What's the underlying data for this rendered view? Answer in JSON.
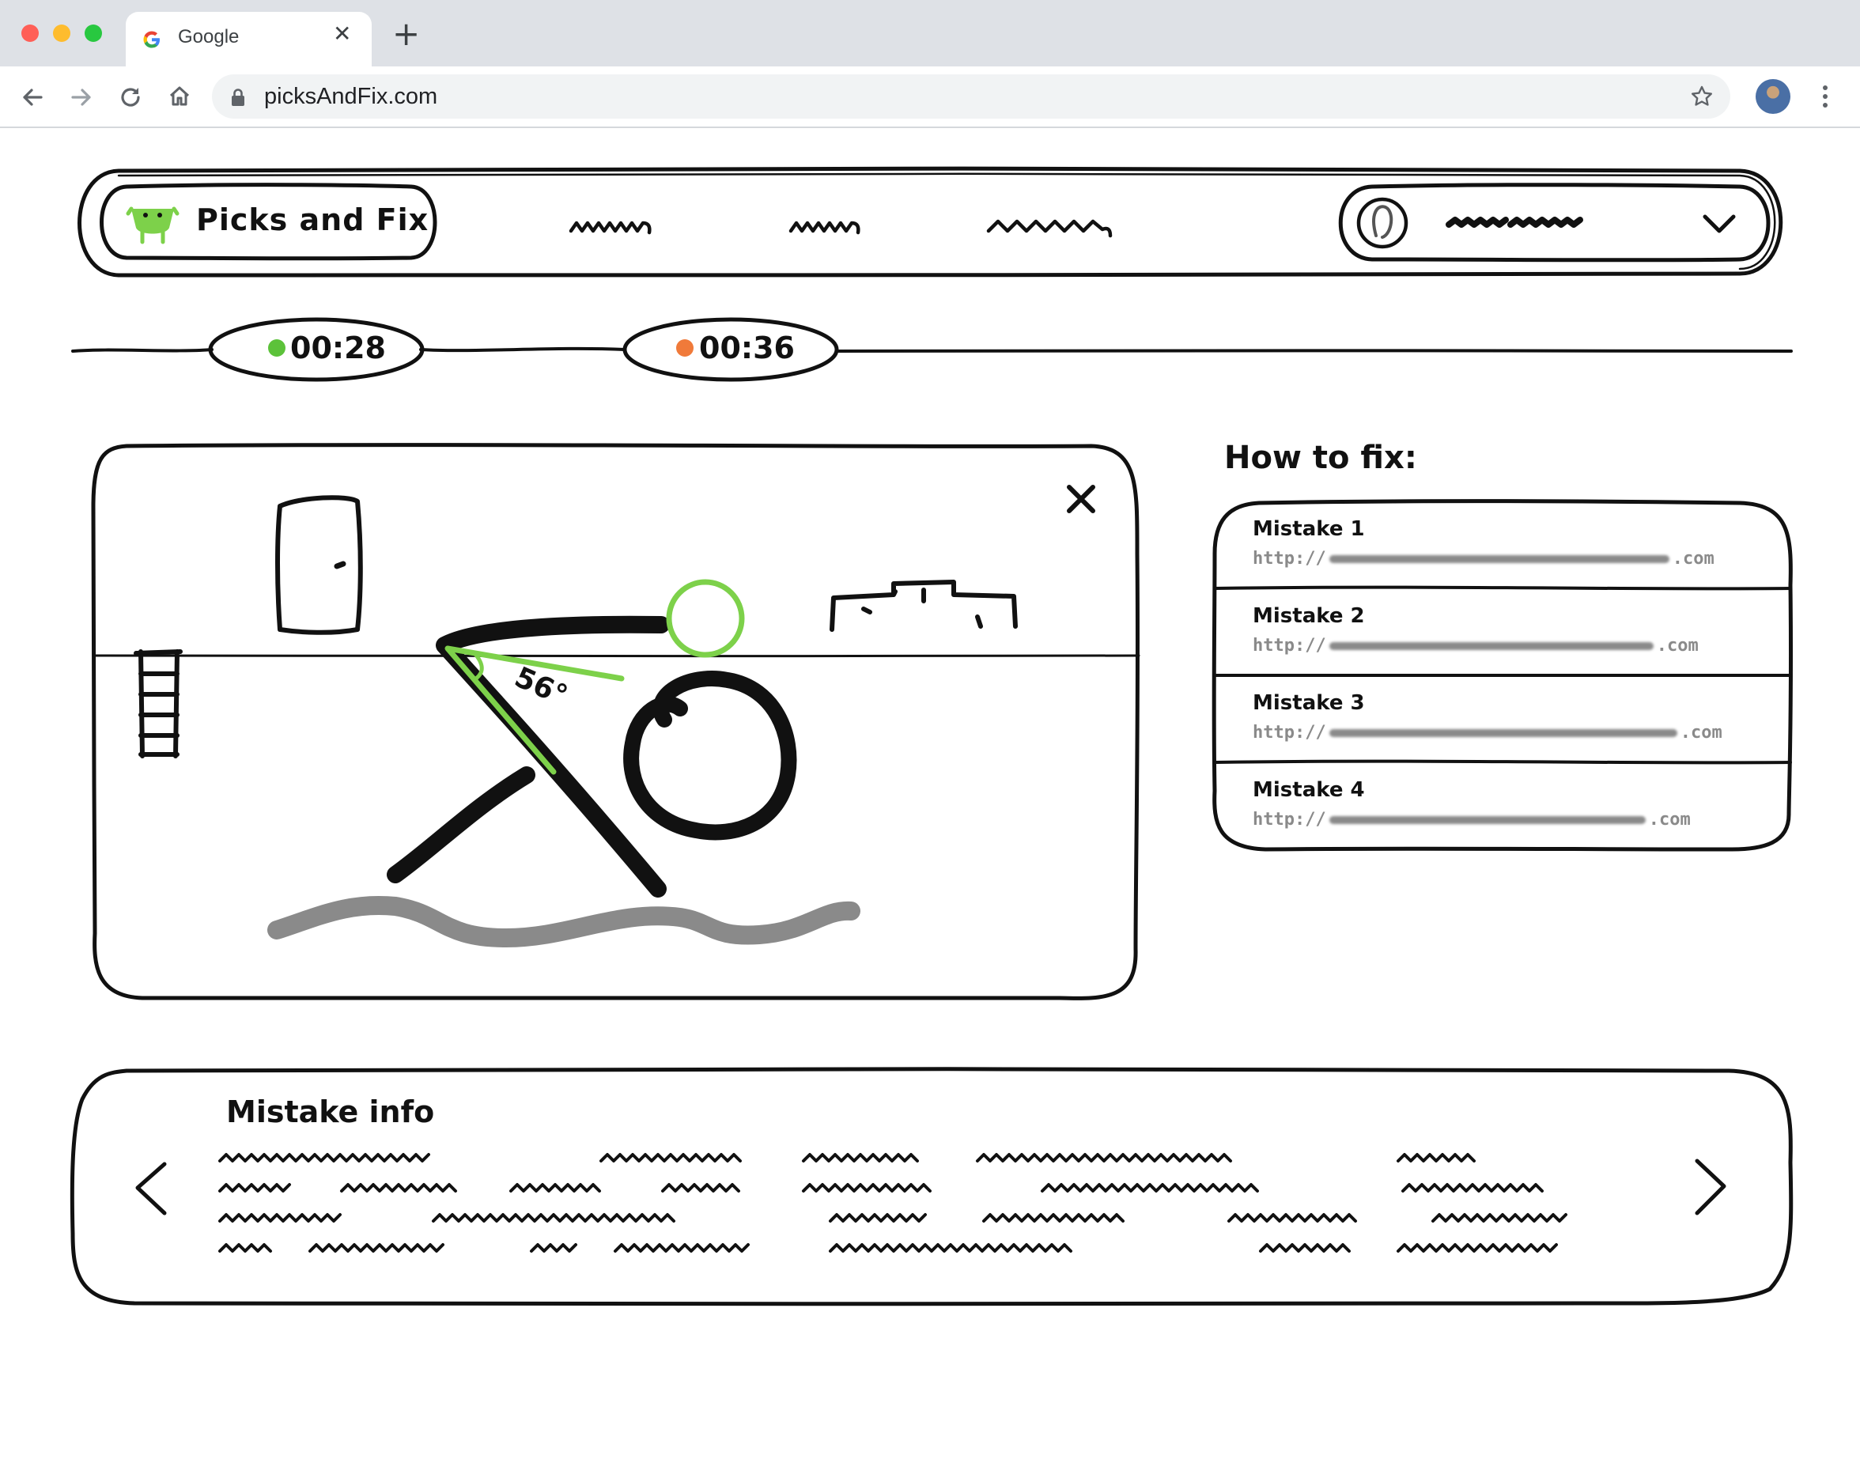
{
  "browser": {
    "tab_title": "Google",
    "url": "picksAndFix.com",
    "window_controls": [
      "close",
      "minimize",
      "maximize"
    ],
    "icons": [
      "google-logo-icon",
      "tab-close-icon",
      "new-tab-icon",
      "back-icon",
      "forward-icon",
      "reload-icon",
      "home-icon",
      "lock-icon",
      "bookmark-star-icon",
      "profile-avatar",
      "menu-kebab-icon"
    ]
  },
  "header": {
    "logo_text": "Picks and Fix"
  },
  "timers": [
    {
      "time": "00:28",
      "status_color": "#5cc23a"
    },
    {
      "time": "00:36",
      "status_color": "#f07a3a"
    }
  ],
  "workout": {
    "angle_label": "56°",
    "accent_color": "#7dd14a"
  },
  "how_to_fix": {
    "title": "How to fix:",
    "mistakes": [
      {
        "title": "Mistake 1",
        "url_prefix": "http://",
        "url_suffix": ".com"
      },
      {
        "title": "Mistake 2",
        "url_prefix": "http://",
        "url_suffix": ".com"
      },
      {
        "title": "Mistake 3",
        "url_prefix": "http://",
        "url_suffix": ".com"
      },
      {
        "title": "Mistake 4",
        "url_prefix": "http://",
        "url_suffix": ".com"
      }
    ]
  },
  "mistake_info": {
    "title": "Mistake info"
  },
  "colors": {
    "stroke": "#111111",
    "accent_green": "#7dd14a",
    "placeholder_gray": "#8a8a8a"
  }
}
